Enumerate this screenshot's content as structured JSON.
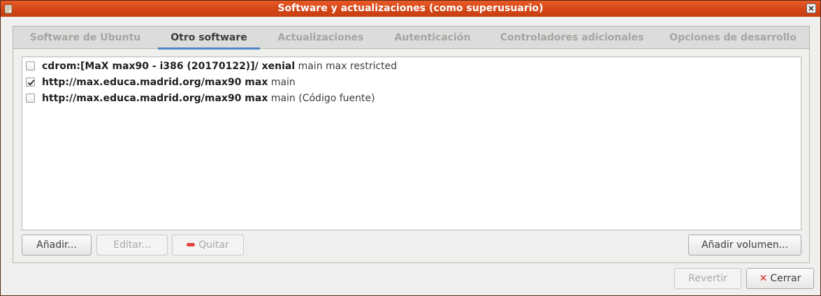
{
  "window": {
    "title": "Software y actualizaciones (como superusuario)"
  },
  "tabs": [
    {
      "label": "Software de Ubuntu",
      "active": false
    },
    {
      "label": "Otro software",
      "active": true
    },
    {
      "label": "Actualizaciones",
      "active": false
    },
    {
      "label": "Autenticación",
      "active": false
    },
    {
      "label": "Controladores adicionales",
      "active": false
    },
    {
      "label": "Opciones de desarrollo",
      "active": false
    }
  ],
  "sources": [
    {
      "checked": false,
      "bold": "cdrom:[MaX max90 - i386 (20170122)]/ xenial",
      "normal": " main max restricted"
    },
    {
      "checked": true,
      "bold": "http://max.educa.madrid.org/max90 max",
      "normal": " main"
    },
    {
      "checked": false,
      "bold": "http://max.educa.madrid.org/max90 max",
      "normal": " main (Código fuente)"
    }
  ],
  "list_buttons": {
    "add": "Añadir...",
    "edit": "Editar...",
    "remove": "Quitar",
    "add_volume": "Añadir volumen..."
  },
  "dialog_buttons": {
    "revert": "Revertir",
    "close": "Cerrar"
  },
  "colors": {
    "titlebar": "#d44516",
    "tab_underline": "#4d87c7",
    "remove_icon": "#e0433f",
    "close_icon": "#d8261d"
  },
  "icons": {
    "app": "software-properties-icon",
    "window_close": "close-icon",
    "remove": "remove-icon",
    "close_button": "close-x-icon",
    "check": "checkmark-icon"
  }
}
